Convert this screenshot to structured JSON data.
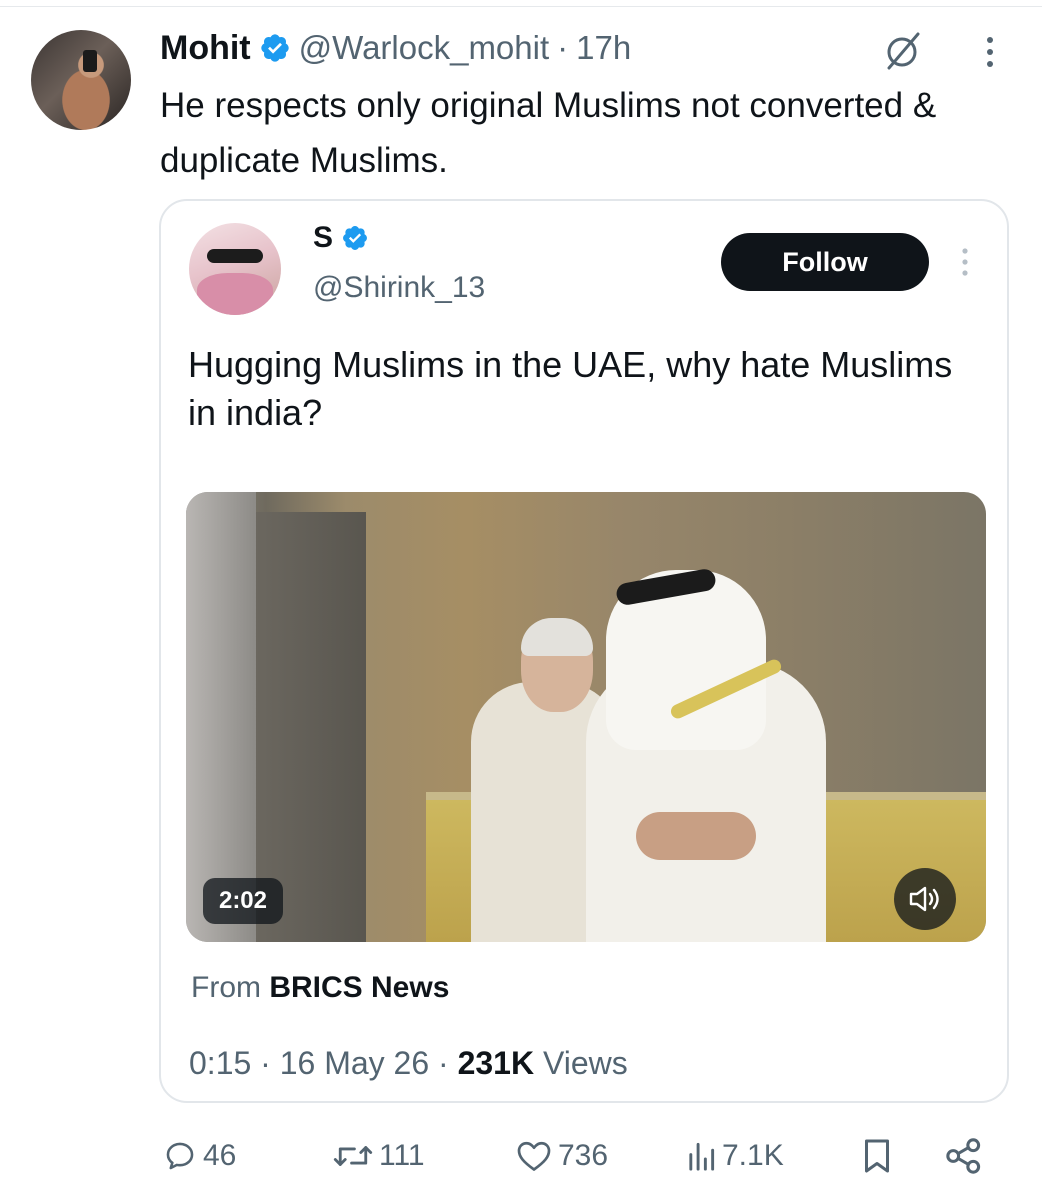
{
  "tweet": {
    "author": {
      "display_name": "Mohit",
      "handle": "@Warlock_mohit",
      "time": "17h",
      "separator": "·"
    },
    "text": "He respects only original Muslims not converted & duplicate Muslims."
  },
  "quote": {
    "author": {
      "display_name": "S",
      "handle": "@Shirink_13"
    },
    "follow_label": "Follow",
    "text": "Hugging Muslims in the UAE, why hate Muslims in india?",
    "video": {
      "duration": "2:02"
    },
    "from_prefix": "From",
    "from_source": "BRICS News",
    "meta": {
      "time": "0:15",
      "date": "16 May 26",
      "views_count": "231K",
      "views_label": "Views",
      "separator": "·"
    }
  },
  "actions": {
    "replies": "46",
    "reposts": "111",
    "likes": "736",
    "views": "7.1K"
  },
  "colors": {
    "verified": "#1d9bf0",
    "text": "#0f1419",
    "secondary": "#536471",
    "border": "#e2e6ea"
  },
  "icons": [
    "verified-icon",
    "grok-icon",
    "more-icon",
    "volume-icon",
    "reply-icon",
    "repost-icon",
    "like-icon",
    "views-icon",
    "bookmark-icon",
    "share-icon"
  ]
}
